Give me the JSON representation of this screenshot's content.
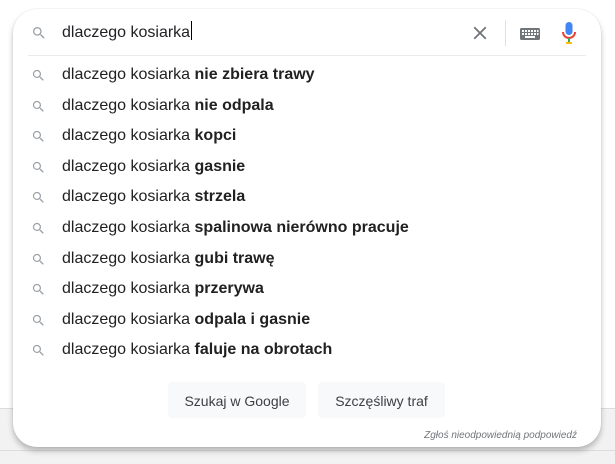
{
  "search": {
    "query": "dlaczego kosiarka",
    "icons": {
      "search": "search-icon",
      "clear": "close-icon",
      "keyboard": "keyboard-icon",
      "voice": "microphone-icon"
    },
    "colors": {
      "mic_blue": "#4285f4",
      "mic_stand": "#34a853",
      "icon_gray": "#70757a"
    }
  },
  "suggestions": [
    {
      "prefix": "dlaczego kosiarka ",
      "completion": "nie zbiera trawy"
    },
    {
      "prefix": "dlaczego kosiarka ",
      "completion": "nie odpala"
    },
    {
      "prefix": "dlaczego kosiarka ",
      "completion": "kopci"
    },
    {
      "prefix": "dlaczego kosiarka ",
      "completion": "gasnie"
    },
    {
      "prefix": "dlaczego kosiarka ",
      "completion": "strzela"
    },
    {
      "prefix": "dlaczego kosiarka ",
      "completion": "spalinowa nierówno pracuje"
    },
    {
      "prefix": "dlaczego kosiarka ",
      "completion": "gubi trawę"
    },
    {
      "prefix": "dlaczego kosiarka ",
      "completion": "przerywa"
    },
    {
      "prefix": "dlaczego kosiarka ",
      "completion": "odpala i gasnie"
    },
    {
      "prefix": "dlaczego kosiarka ",
      "completion": "faluje na obrotach"
    }
  ],
  "buttons": {
    "search_label": "Szukaj w Google",
    "lucky_label": "Szczęśliwy traf"
  },
  "report_link": "Zgłoś nieodpowiednią podpowiedź"
}
